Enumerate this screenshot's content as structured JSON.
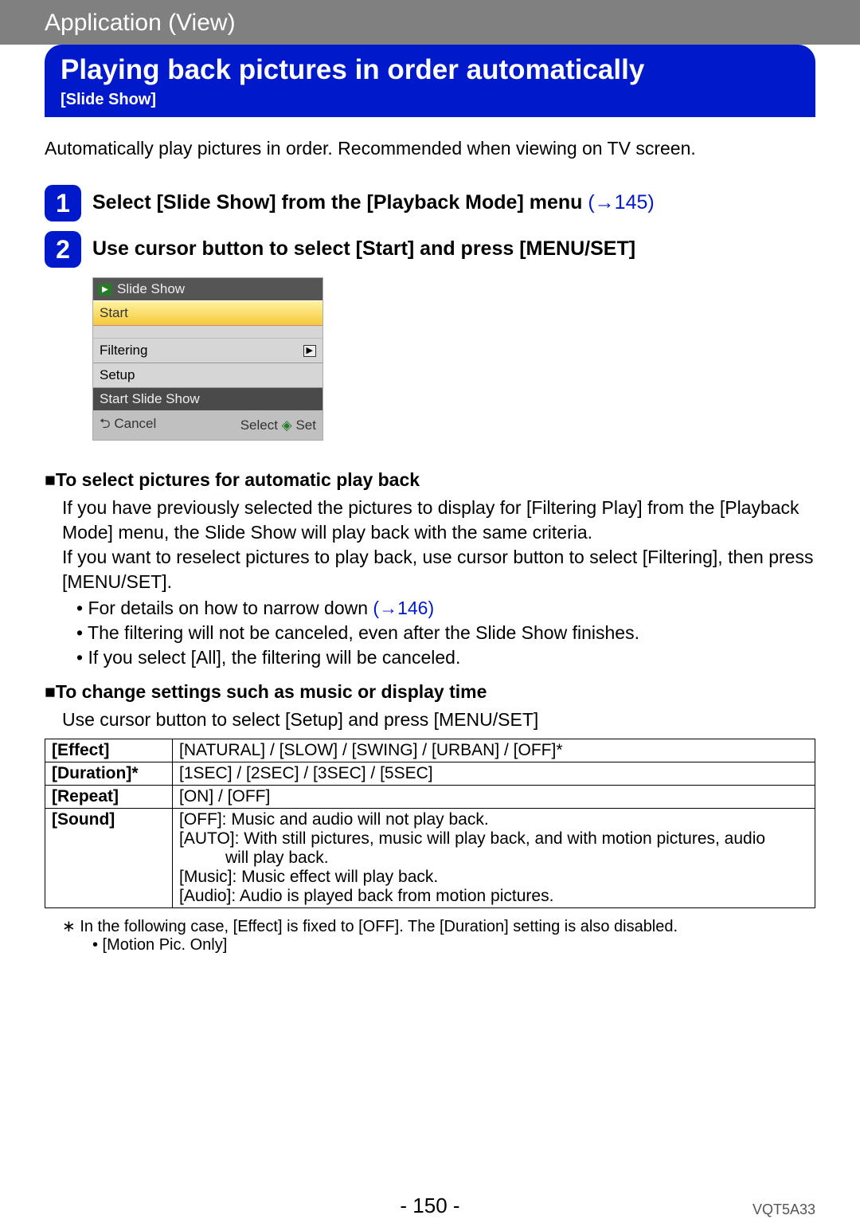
{
  "header": {
    "breadcrumb": "Application (View)"
  },
  "title": {
    "main": "Playing back pictures in order automatically",
    "sub": "[Slide Show]"
  },
  "intro": "Automatically play pictures in order. Recommended when viewing on TV screen.",
  "steps": [
    {
      "num": "1",
      "text": "Select [Slide Show] from the [Playback Mode] menu ",
      "link": "(→145)"
    },
    {
      "num": "2",
      "text": "Use cursor button to select [Start] and press [MENU/SET]",
      "link": ""
    }
  ],
  "camera_menu": {
    "title": "Slide Show",
    "start": "Start",
    "filtering": "Filtering",
    "setup": "Setup",
    "status": "Start Slide Show",
    "cancel": "Cancel",
    "select_set": "Select ",
    "set": " Set"
  },
  "sect1": {
    "heading": "■To select pictures for automatic play back",
    "para": "If you have previously selected the pictures to display for [Filtering Play] from the [Playback Mode] menu, the Slide Show will play back with the same criteria.\nIf you want to reselect pictures to play back, use cursor button to select [Filtering], then press [MENU/SET].",
    "bullet1_pre": "For details on how to narrow down ",
    "bullet1_link": "(→146)",
    "bullet2": "The filtering will not be canceled, even after the Slide Show finishes.",
    "bullet3": "If you select [All], the filtering will be canceled."
  },
  "sect2": {
    "heading": "■To change settings such as music or display time",
    "para": "Use cursor button to select [Setup] and press [MENU/SET]"
  },
  "table": {
    "rows": [
      {
        "label": "[Effect]",
        "value": "[NATURAL] / [SLOW] / [SWING] / [URBAN] / [OFF]*"
      },
      {
        "label": "[Duration]*",
        "value": "[1SEC] / [2SEC] / [3SEC] / [5SEC]"
      },
      {
        "label": "[Repeat]",
        "value": "[ON] / [OFF]"
      }
    ],
    "sound": {
      "label": "[Sound]",
      "lines": {
        "off": "[OFF]: Music and audio will not play back.",
        "auto1": "[AUTO]: With still pictures, music will play back, and with motion pictures, audio",
        "auto2": "will play back.",
        "music": "[Music]: Music effect will play back.",
        "audio": "[Audio]: Audio is played back from motion pictures."
      }
    }
  },
  "footnote": {
    "main": "∗ In the following case, [Effect] is fixed to [OFF]. The [Duration] setting is also disabled.",
    "sub": "• [Motion Pic. Only]"
  },
  "footer": {
    "page": "- 150 -",
    "docid": "VQT5A33"
  }
}
